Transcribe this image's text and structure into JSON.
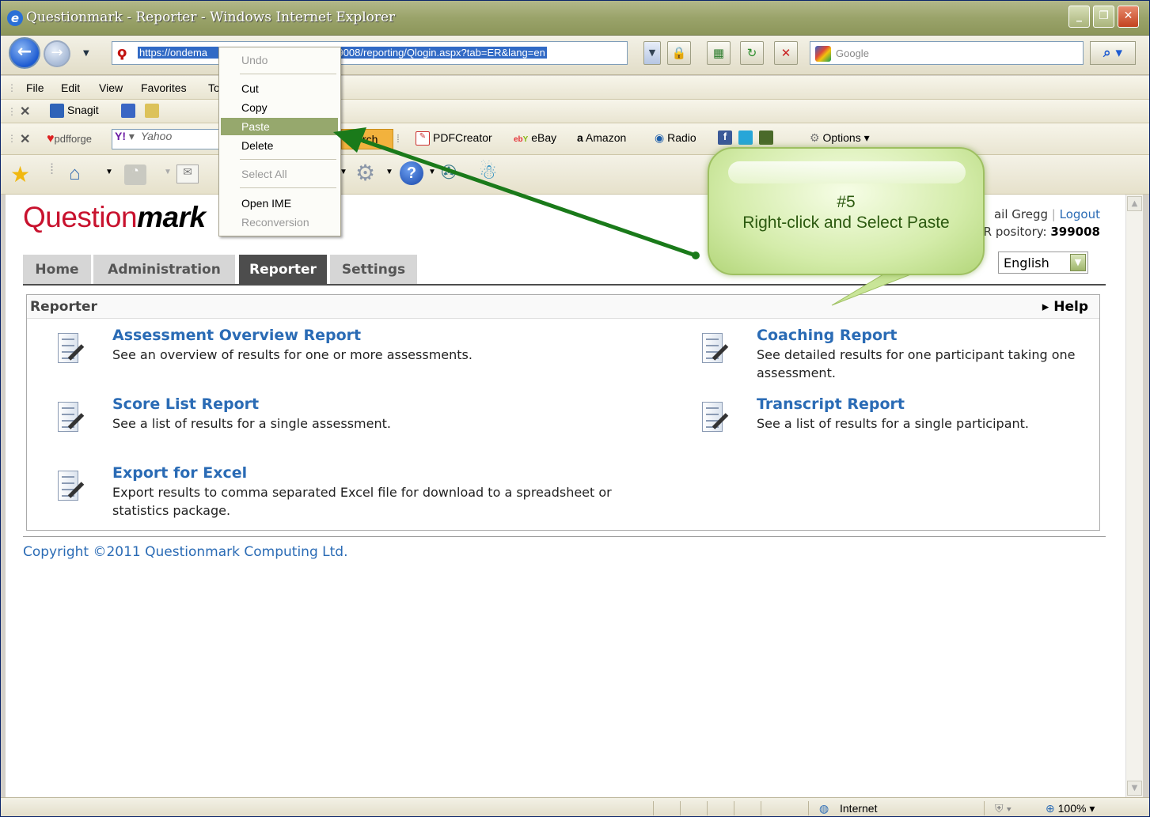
{
  "window": {
    "title": "Questionmark - Reporter - Windows Internet Explorer"
  },
  "address": {
    "url": "https://ondema",
    "url_tail": "399008/reporting/Qlogin.aspx?tab=ER&lang=en"
  },
  "search": {
    "placeholder": "Google"
  },
  "menu": {
    "file": "File",
    "edit": "Edit",
    "view": "View",
    "favorites": "Favorites",
    "tools": "To"
  },
  "snagit": {
    "label": "Snagit"
  },
  "linkbar": {
    "pdfforge": "pdfforge",
    "yahoo": "Yahoo",
    "search_frag": "rch",
    "pdfcreator": "PDFCreator",
    "ebay": "eBay",
    "amazon": "Amazon",
    "radio": "Radio",
    "options": "Options"
  },
  "context_menu": {
    "undo": "Undo",
    "cut": "Cut",
    "copy": "Copy",
    "paste": "Paste",
    "delete": "Delete",
    "select_all": "Select All",
    "open_ime": "Open IME",
    "reconversion": "Reconversion"
  },
  "callout": {
    "step": "#5",
    "text": "Right-click and Select Paste"
  },
  "header": {
    "logo_a": "Question",
    "logo_b": "mark",
    "user_name": "ail Gregg",
    "logout": "Logout",
    "repo_label": "R  pository:",
    "repo_id": "399008",
    "language": "English"
  },
  "tabs": [
    "Home",
    "Administration",
    "Reporter",
    "Settings"
  ],
  "panel": {
    "title": "Reporter",
    "help": "Help"
  },
  "reports": [
    {
      "name": "Assessment Overview Report",
      "desc": "See an overview of results for one or more assessments."
    },
    {
      "name": "Coaching Report",
      "desc": "See detailed results for one participant taking one assessment."
    },
    {
      "name": "Score List Report",
      "desc": "See a list of results for a single assessment."
    },
    {
      "name": "Transcript Report",
      "desc": "See a list of results for a single participant."
    },
    {
      "name": "Export for Excel",
      "desc": "Export results to comma separated Excel file for download to a spreadsheet or statistics package."
    }
  ],
  "footer": {
    "copyright": "Copyright ©2011 Questionmark Computing Ltd."
  },
  "status": {
    "zone": "Internet",
    "zoom": "100%"
  },
  "colors": {
    "accent_green": "#96a86d",
    "link_blue": "#2a6bb5",
    "logo_red": "#c8122e",
    "arrow_green": "#1a7a1a"
  }
}
